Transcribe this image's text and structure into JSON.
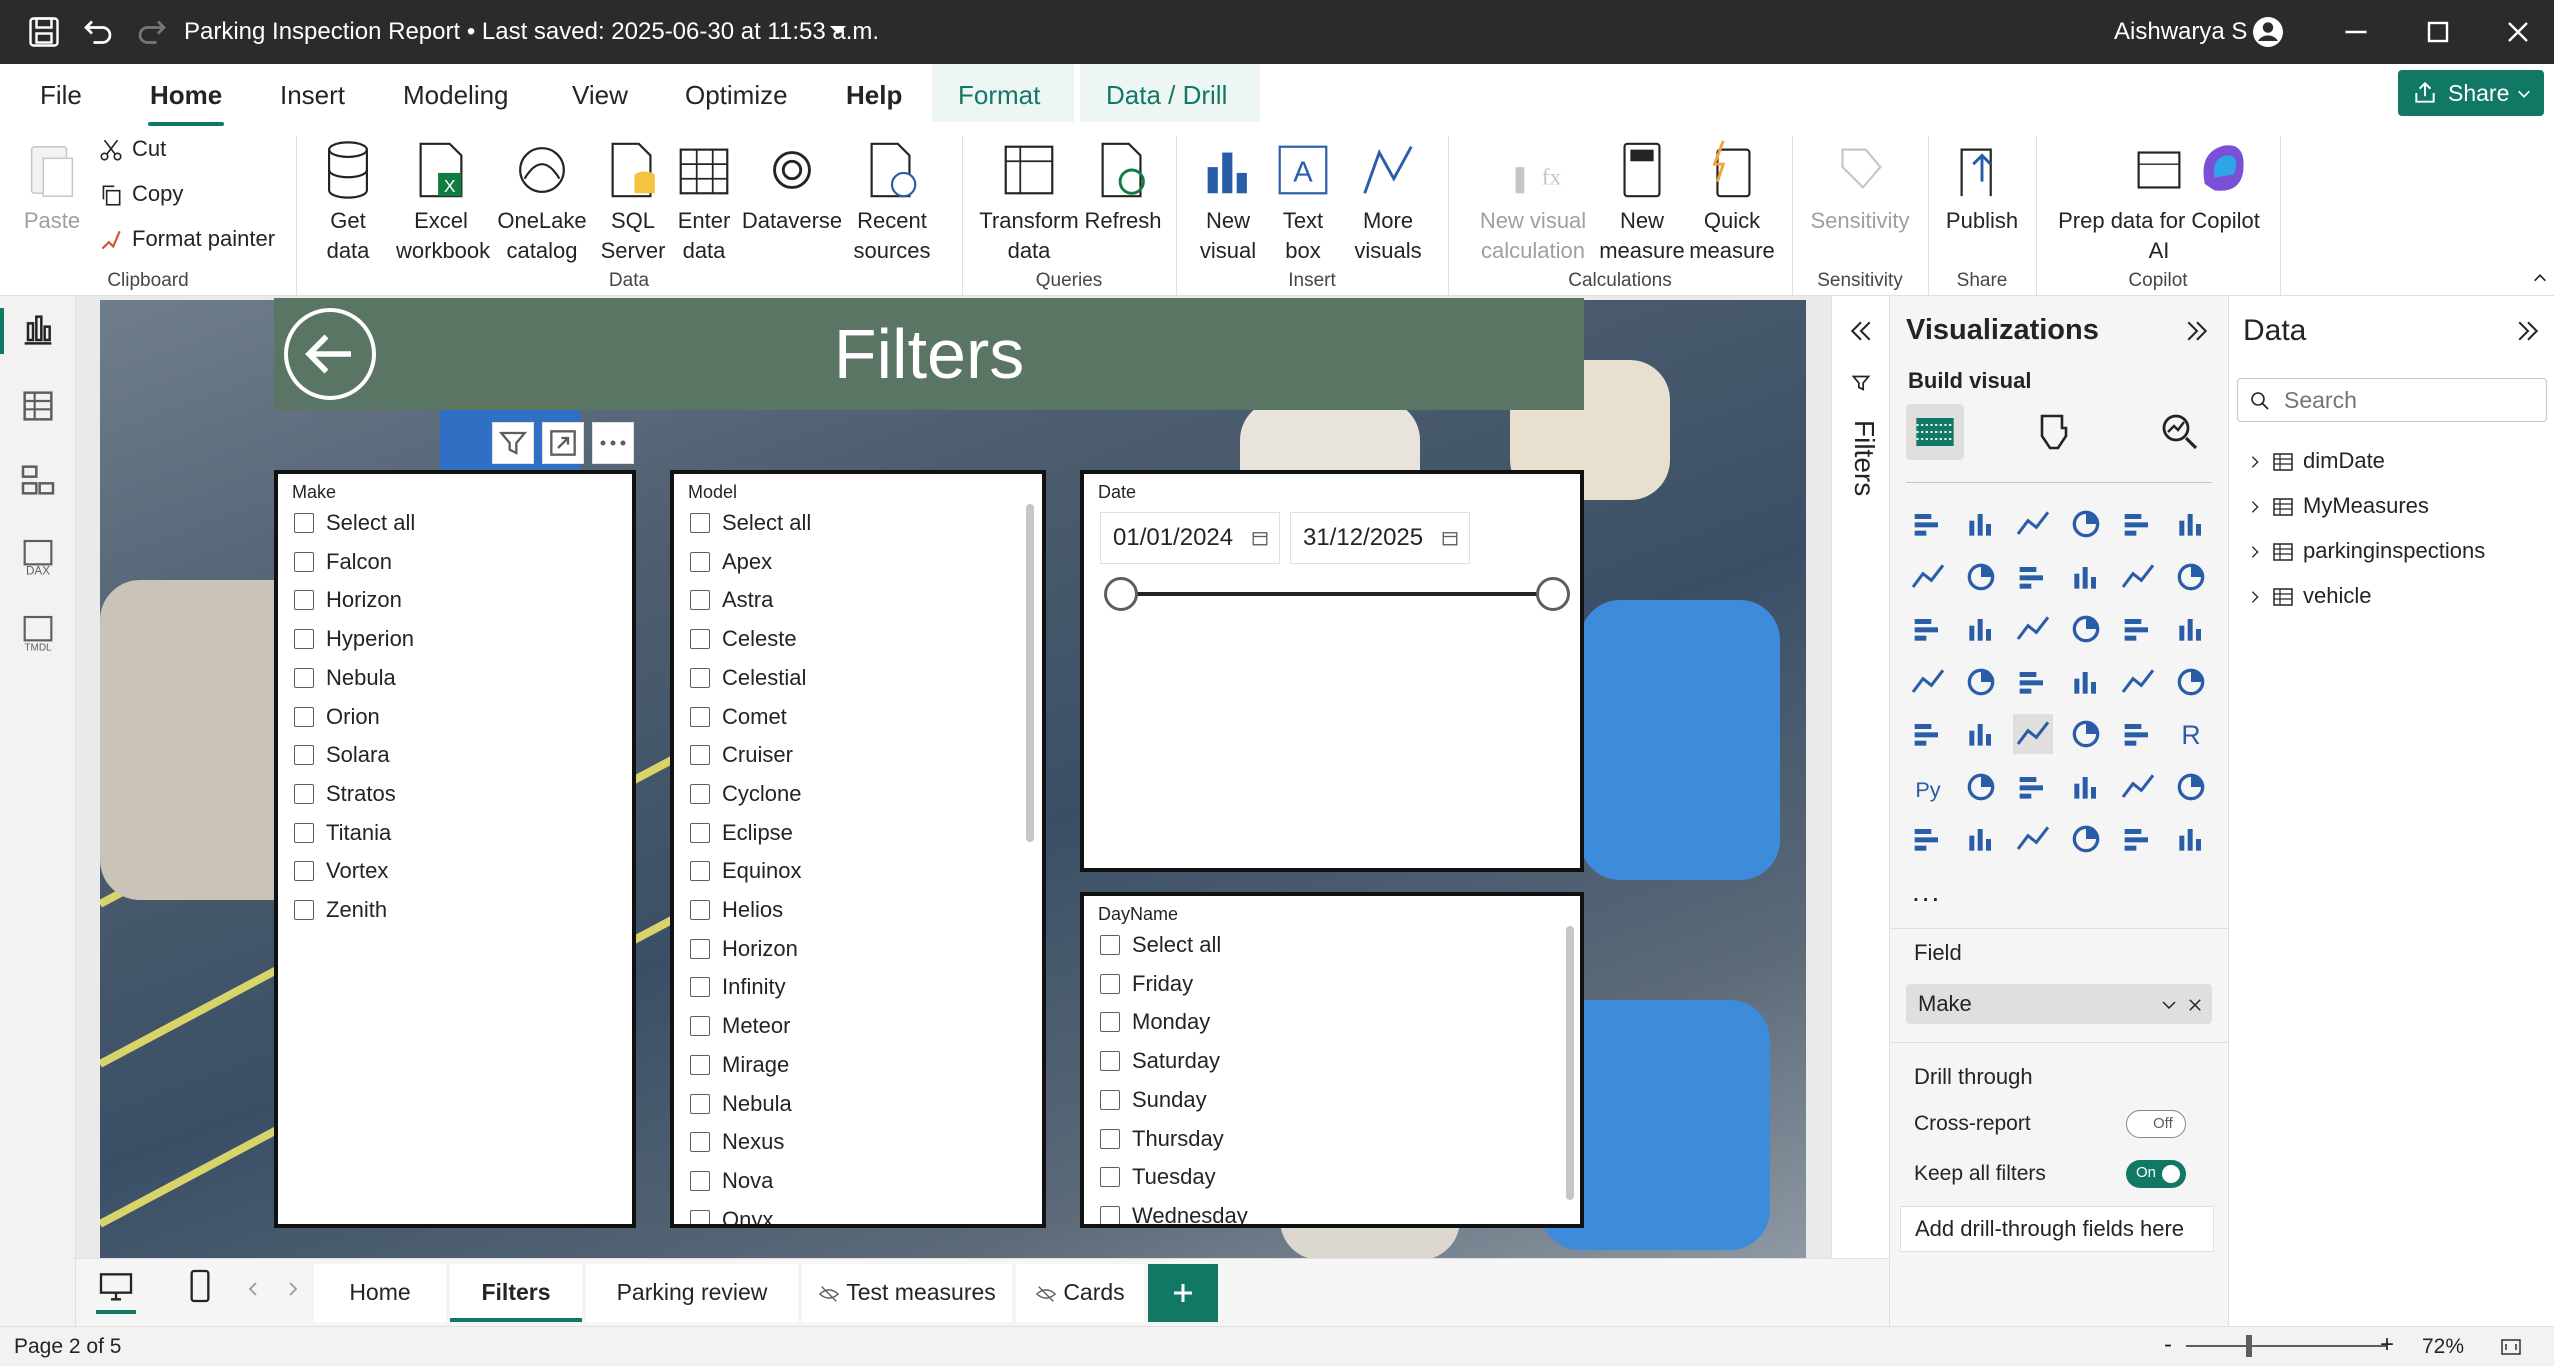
{
  "titlebar": {
    "title": "Parking Inspection Report • Last saved: 2025-06-30 at 11:53 a.m.",
    "user": "Aishwarya S"
  },
  "ribbon_tabs": [
    "File",
    "Home",
    "Insert",
    "Modeling",
    "View",
    "Optimize",
    "Help",
    "Format",
    "Data / Drill"
  ],
  "share_label": "Share",
  "ribbon": {
    "clipboard": {
      "paste": "Paste",
      "cut": "Cut",
      "copy": "Copy",
      "format_painter": "Format painter",
      "group": "Clipboard"
    },
    "data": {
      "get_data": [
        "Get",
        "data"
      ],
      "excel": [
        "Excel",
        "workbook"
      ],
      "onelake": [
        "OneLake",
        "catalog"
      ],
      "sql": [
        "SQL",
        "Server"
      ],
      "enter": [
        "Enter",
        "data"
      ],
      "dataverse": "Dataverse",
      "recent": [
        "Recent",
        "sources"
      ],
      "group": "Data"
    },
    "queries": {
      "transform": [
        "Transform",
        "data"
      ],
      "refresh": "Refresh",
      "group": "Queries"
    },
    "insert": {
      "new_visual": [
        "New",
        "visual"
      ],
      "text_box": [
        "Text",
        "box"
      ],
      "more_visuals": [
        "More",
        "visuals"
      ],
      "group": "Insert"
    },
    "calculations": {
      "new_visual_calc": [
        "New visual",
        "calculation"
      ],
      "new_measure": [
        "New",
        "measure"
      ],
      "quick_measure": [
        "Quick",
        "measure"
      ],
      "group": "Calculations"
    },
    "sensitivity": {
      "label": "Sensitivity",
      "group": "Sensitivity"
    },
    "share": {
      "publish": "Publish",
      "group": "Share"
    },
    "copilot": {
      "prep": [
        "Prep data for Copilot",
        "AI"
      ],
      "group": "Copilot"
    }
  },
  "report": {
    "page_title": "Filters",
    "make_slicer": {
      "title": "Make",
      "options": [
        "Select all",
        "Falcon",
        "Horizon",
        "Hyperion",
        "Nebula",
        "Orion",
        "Solara",
        "Stratos",
        "Titania",
        "Vortex",
        "Zenith"
      ]
    },
    "model_slicer": {
      "title": "Model",
      "options": [
        "Select all",
        "Apex",
        "Astra",
        "Celeste",
        "Celestial",
        "Comet",
        "Cruiser",
        "Cyclone",
        "Eclipse",
        "Equinox",
        "Helios",
        "Horizon",
        "Infinity",
        "Meteor",
        "Mirage",
        "Nebula",
        "Nexus",
        "Nova",
        "Onyx"
      ]
    },
    "date_slicer": {
      "title": "Date",
      "start": "01/01/2024",
      "end": "31/12/2025"
    },
    "dayname_slicer": {
      "title": "DayName",
      "options": [
        "Select all",
        "Friday",
        "Monday",
        "Saturday",
        "Sunday",
        "Thursday",
        "Tuesday",
        "Wednesday"
      ]
    }
  },
  "filters_pane_label": "Filters",
  "visualizations": {
    "title": "Visualizations",
    "build_visual": "Build visual",
    "more": "...",
    "field_label": "Field",
    "field_value": "Make",
    "drill_through": "Drill through",
    "cross_report": "Cross-report",
    "cross_report_state": "Off",
    "keep_all_filters": "Keep all filters",
    "keep_all_filters_state": "On",
    "add_drill": "Add drill-through fields here"
  },
  "data_pane": {
    "title": "Data",
    "search_placeholder": "Search",
    "tables": [
      "dimDate",
      "MyMeasures",
      "parkinginspections",
      "vehicle"
    ]
  },
  "page_tabs": [
    "Home",
    "Filters",
    "Parking review",
    "Test measures",
    "Cards"
  ],
  "status": {
    "page": "Page 2 of 5",
    "zoom": "72%"
  },
  "colors": {
    "accent": "#117865",
    "banner": "#5a7563",
    "titlebar": "#2b2b2b",
    "ribbon_icon_blue": "#2a5da8"
  }
}
